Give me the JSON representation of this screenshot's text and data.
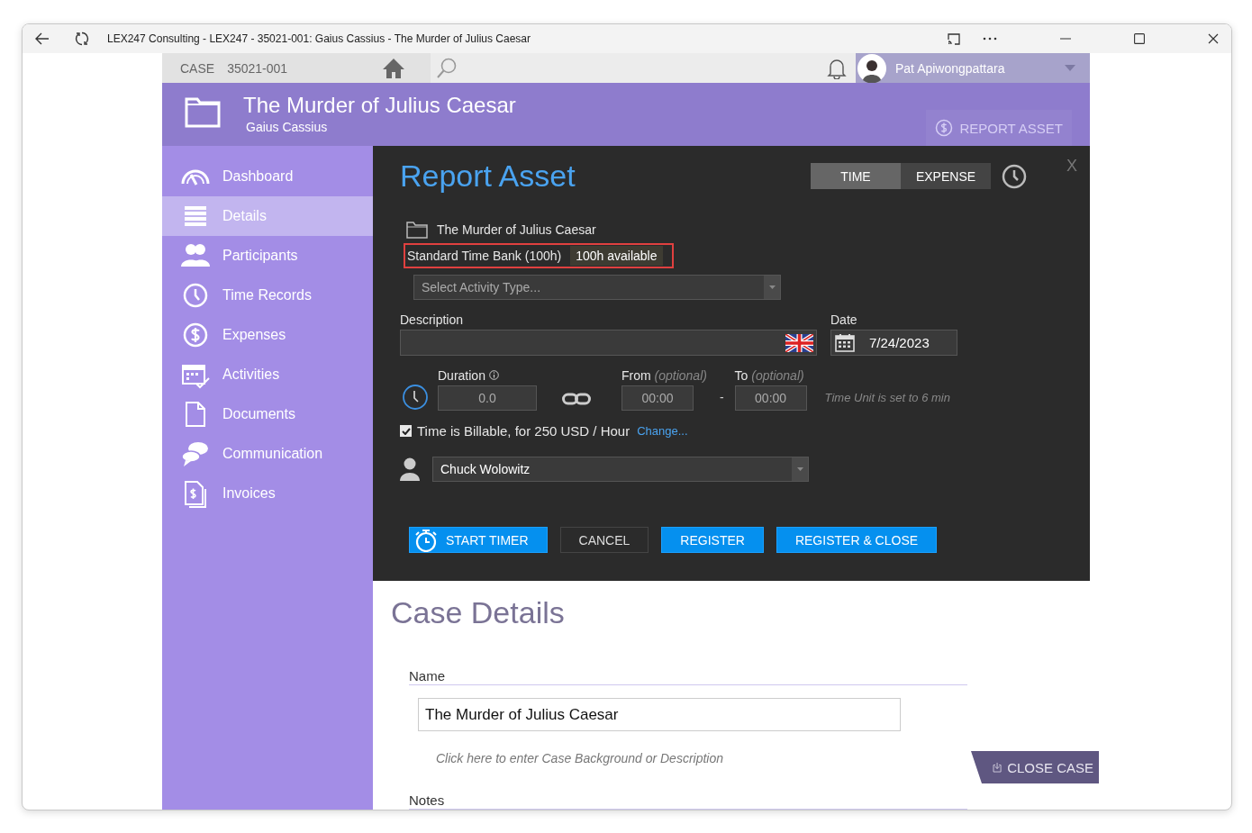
{
  "window": {
    "title": "LEX247 Consulting - LEX247 - 35021-001: Gaius Cassius - The Murder of Julius Caesar"
  },
  "topbar": {
    "case_label": "CASE",
    "case_number": "35021-001",
    "user_name": "Pat Apiwongpattara"
  },
  "header": {
    "title": "The Murder of Julius Caesar",
    "subtitle": "Gaius Cassius",
    "report_button": {
      "label": "REPORT ASSET",
      "disabled": true
    }
  },
  "sidebar": {
    "items": [
      {
        "label": "Dashboard",
        "selected": false
      },
      {
        "label": "Details",
        "selected": true
      },
      {
        "label": "Participants",
        "selected": false
      },
      {
        "label": "Time Records",
        "selected": false
      },
      {
        "label": "Expenses",
        "selected": false
      },
      {
        "label": "Activities",
        "selected": false
      },
      {
        "label": "Documents",
        "selected": false
      },
      {
        "label": "Communication",
        "selected": false
      },
      {
        "label": "Invoices",
        "selected": false
      }
    ]
  },
  "dialog": {
    "title": "Report Asset",
    "close": "X",
    "tabs": [
      {
        "label": "TIME",
        "selected": true
      },
      {
        "label": "EXPENSE",
        "selected": false
      }
    ],
    "case_name": "The Murder of Julius Caesar",
    "time_bank": {
      "label": "Standard Time Bank (100h)",
      "available": "100h available"
    },
    "activity": {
      "placeholder": "Select Activity Type..."
    },
    "description": {
      "label": "Description"
    },
    "date": {
      "label": "Date",
      "value": "7/24/2023"
    },
    "duration": {
      "label": "Duration",
      "value": "0.0"
    },
    "from": {
      "label": "From",
      "hint": "(optional)",
      "value": "00:00"
    },
    "separator": "-",
    "to": {
      "label": "To",
      "hint": "(optional)",
      "value": "00:00"
    },
    "time_unit_note": "Time Unit is set to 6 min",
    "billable": {
      "checked": true,
      "text": "Time is Billable, for 250 USD / Hour",
      "link": "Change..."
    },
    "user": {
      "value": "Chuck Wolowitz"
    },
    "buttons": [
      {
        "label": "START TIMER",
        "kind": "timer"
      },
      {
        "label": "CANCEL",
        "kind": "plain"
      },
      {
        "label": "REGISTER",
        "kind": "primary"
      },
      {
        "label": "REGISTER & CLOSE",
        "kind": "primary"
      }
    ]
  },
  "case_details": {
    "title": "Case Details",
    "name_label": "Name",
    "name_value": "The Murder of Julius Caesar",
    "description_placeholder": "Click here to enter Case Background or Description",
    "notes_label": "Notes",
    "close_case": "CLOSE CASE"
  }
}
